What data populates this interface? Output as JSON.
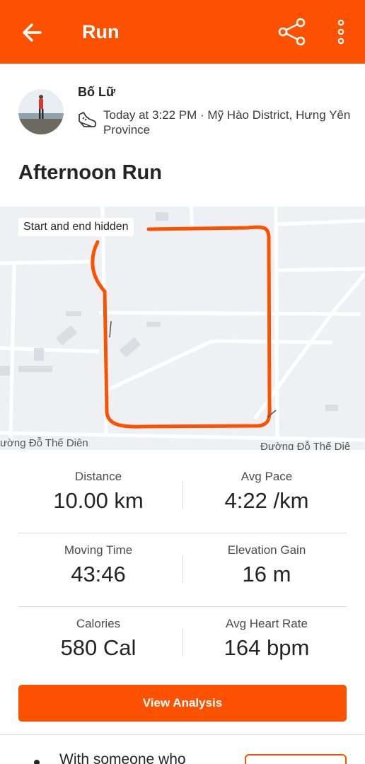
{
  "header": {
    "title": "Run",
    "back_icon": "back-arrow-icon",
    "share_icon": "share-icon",
    "more_icon": "more-vertical-icon",
    "color": "#fc5200"
  },
  "athlete": {
    "name": "Bố Lữ",
    "activity_icon": "running-shoe-icon",
    "meta": "Today at 3:22 PM · Mỹ Hào District, Hưng Yên Province"
  },
  "activity": {
    "title": "Afternoon Run"
  },
  "map": {
    "badge": "Start and end hidden",
    "street_left": "ường Đỗ Thế Diên",
    "street_right": "Đường Đỗ Thế Diê",
    "route_color": "#fc5200"
  },
  "stats": [
    {
      "left": {
        "label": "Distance",
        "value": "10.00 km"
      },
      "right": {
        "label": "Avg Pace",
        "value": "4:22 /km"
      }
    },
    {
      "left": {
        "label": "Moving Time",
        "value": "43:46"
      },
      "right": {
        "label": "Elevation Gain",
        "value": "16 m"
      }
    },
    {
      "left": {
        "label": "Calories",
        "value": "580 Cal"
      },
      "right": {
        "label": "Avg Heart Rate",
        "value": "164 bpm"
      }
    }
  ],
  "actions": {
    "view_analysis": "View Analysis"
  },
  "with_section": {
    "text": "With someone who"
  }
}
